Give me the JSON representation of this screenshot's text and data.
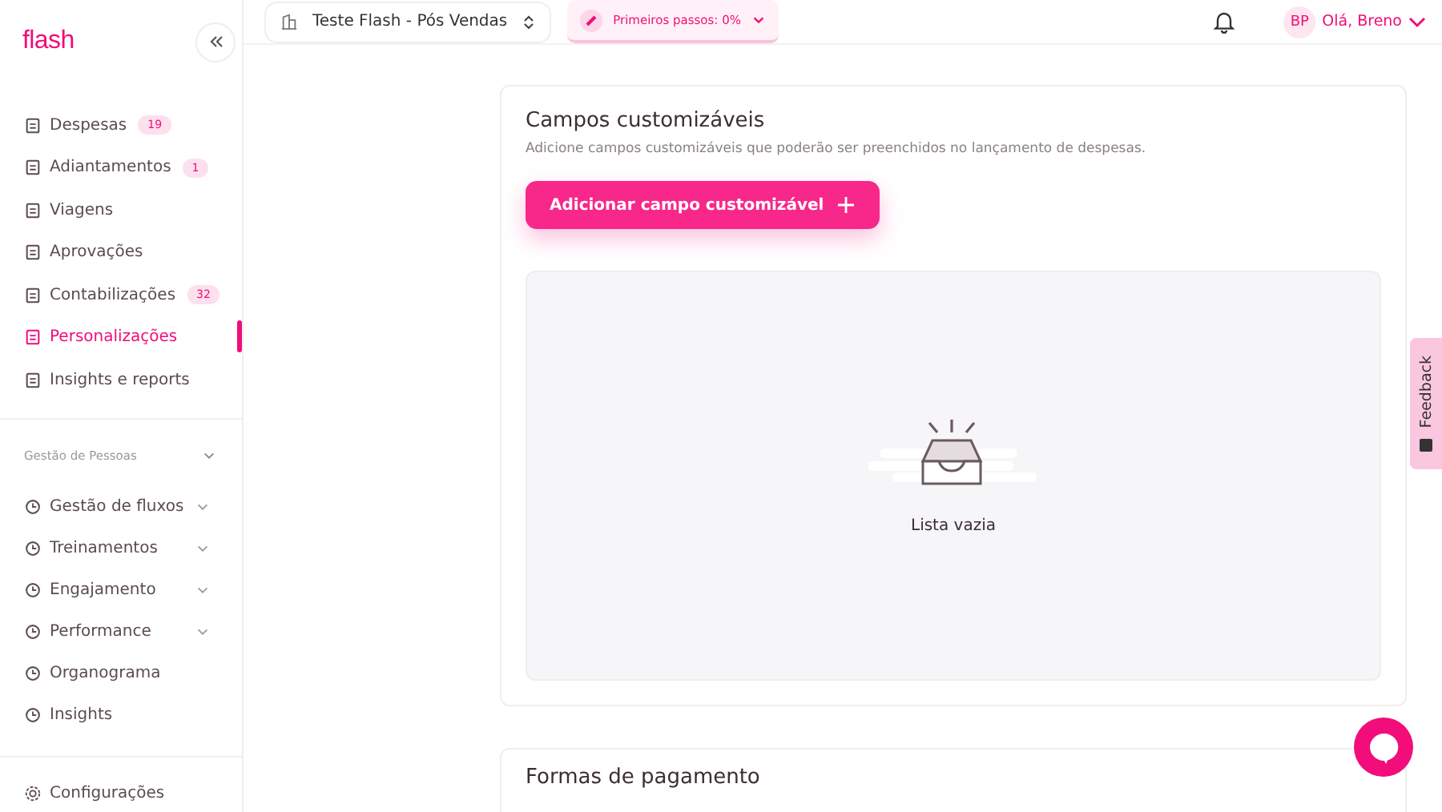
{
  "sidebar": {
    "logo": "flash",
    "items": [
      {
        "label": "Despesas",
        "badge": "19",
        "selected": false
      },
      {
        "label": "Adiantamentos",
        "badge": "1",
        "selected": false
      },
      {
        "label": "Viagens",
        "selected": false
      },
      {
        "label": "Aprovações",
        "selected": false
      },
      {
        "label": "Contabilizações",
        "badge": "32",
        "selected": false
      },
      {
        "label": "Personalizações",
        "selected": true
      },
      {
        "label": "Insights e reports",
        "selected": false
      }
    ],
    "section": {
      "title": "Gestão de Pessoas",
      "expanded": true
    },
    "people_items": [
      {
        "label": "Gestão de fluxos",
        "expanded": false
      },
      {
        "label": "Treinamentos",
        "expanded": false
      },
      {
        "label": "Engajamento",
        "expanded": false
      },
      {
        "label": "Performance",
        "expanded": false
      },
      {
        "label": "Organograma"
      },
      {
        "label": "Insights"
      }
    ],
    "footer_item": {
      "label": "Configurações"
    }
  },
  "topbar": {
    "company": "Teste Flash - Pós Vendas",
    "first_steps": "Primeiros passos: 0%",
    "avatar": "BP",
    "greeting": "Olá, Breno"
  },
  "card": {
    "title": "Campos customizáveis",
    "subtitle": "Adicione campos customizáveis que poderão ser preenchidos no lançamento de despesas.",
    "button": "Adicionar campo customizável",
    "empty": "Lista vazia"
  },
  "next_card": {
    "title": "Formas de pagamento"
  },
  "feedback": "Feedback"
}
